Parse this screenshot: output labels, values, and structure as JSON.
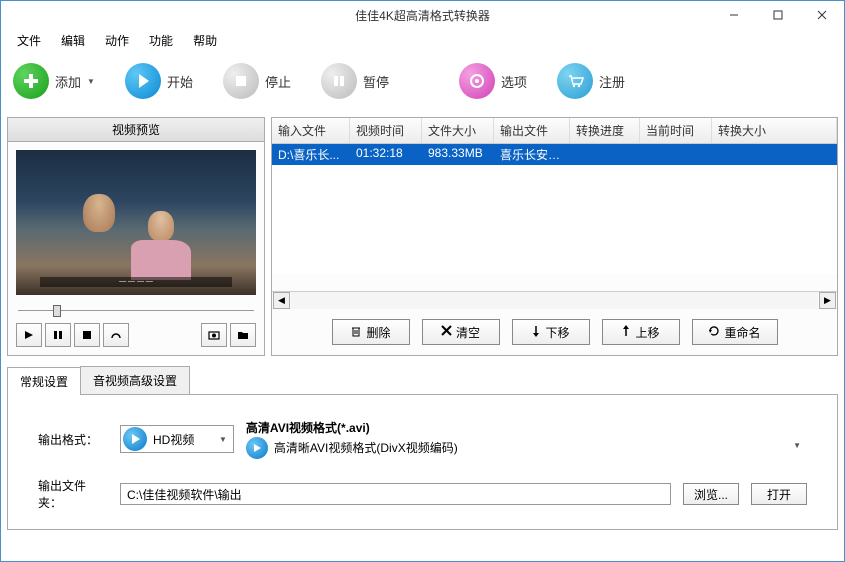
{
  "window": {
    "title": "佳佳4K超高清格式转换器"
  },
  "menu": {
    "file": "文件",
    "edit": "编辑",
    "action": "动作",
    "function": "功能",
    "help": "帮助"
  },
  "toolbar": {
    "add": "添加",
    "start": "开始",
    "stop": "停止",
    "pause": "暂停",
    "options": "选项",
    "register": "注册"
  },
  "preview": {
    "header": "视频预览"
  },
  "table": {
    "headers": {
      "input": "输入文件",
      "duration": "视频时间",
      "size": "文件大小",
      "output": "输出文件",
      "progress": "转换进度",
      "current": "当前时间",
      "convsize": "转换大小"
    },
    "row": {
      "input": "D:\\喜乐长...",
      "duration": "01:32:18",
      "size": "983.33MB",
      "output": "喜乐长安H...",
      "progress": "",
      "current": "",
      "convsize": ""
    }
  },
  "actions": {
    "delete": "删除",
    "clear": "清空",
    "down": "下移",
    "up": "上移",
    "rename": "重命名"
  },
  "tabs": {
    "general": "常规设置",
    "advanced": "音视频高级设置"
  },
  "form": {
    "outformat_label": "输出格式：",
    "category": "HD视频",
    "format_title": "高清AVI视频格式(*.avi)",
    "format_sub": "高清晰AVI视频格式(DivX视频编码)",
    "outfolder_label": "输出文件夹：",
    "outfolder_value": "C:\\佳佳视频软件\\输出",
    "browse": "浏览...",
    "open": "打开"
  }
}
